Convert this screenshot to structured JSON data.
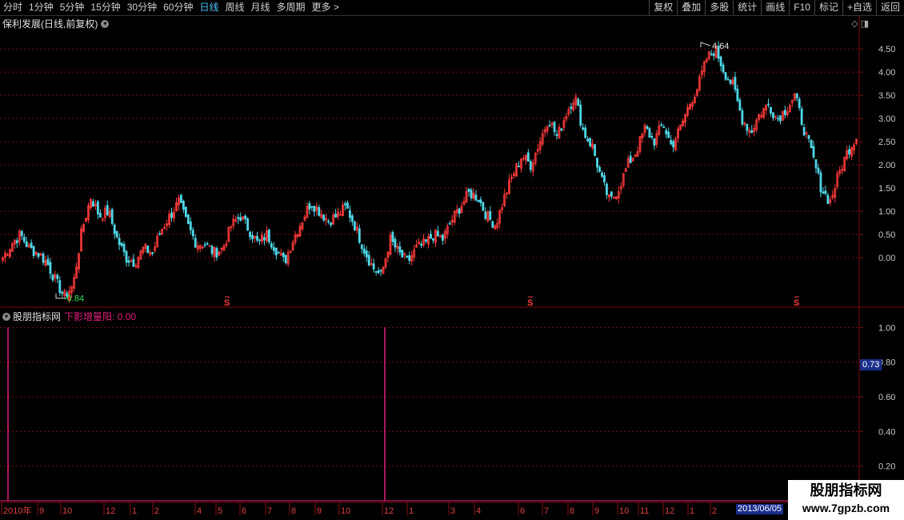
{
  "toolbar": {
    "periods": [
      "分时",
      "1分钟",
      "5分钟",
      "15分钟",
      "30分钟",
      "60分钟",
      "日线",
      "周线",
      "月线",
      "多周期",
      "更多 >"
    ],
    "active_period": "日线",
    "right_buttons": [
      "复权",
      "叠加",
      "多股",
      "统计",
      "画线",
      "F10",
      "标记",
      "+自选",
      "返回"
    ]
  },
  "main_panel": {
    "title": "保利发展(日线,前复权)",
    "icon": "chevron-down-icon",
    "high_label": "4.64",
    "low_label": "-0.84",
    "marker": "S",
    "price_axis": [
      "4.50",
      "4.00",
      "3.50",
      "3.00",
      "2.50",
      "2.00",
      "1.50",
      "1.00",
      "0.50",
      "0.00"
    ]
  },
  "indicator_panel": {
    "title": "股朋指标网",
    "label": "下影增量阳: 0.00",
    "axis": [
      "1.00",
      "0.80",
      "0.60",
      "0.40",
      "0.20"
    ],
    "current_value": "0.73"
  },
  "time_axis": {
    "labels": [
      "2010年",
      "9",
      "10",
      "12",
      "1",
      "2",
      "4",
      "5",
      "6",
      "7",
      "8",
      "9",
      "10",
      "12",
      "1",
      "3",
      "4",
      "6",
      "7",
      "8",
      "9",
      "10",
      "11",
      "12",
      "1",
      "2"
    ],
    "cursor_date": "2013/06/05"
  },
  "watermark": {
    "line1": "股朋指标网",
    "line2": "www.7gpzb.com"
  },
  "colors": {
    "up": "#ff3b3b",
    "down": "#4fd8e8",
    "grid": "#7a0c0c",
    "indicator": "#e0207a",
    "highlight": "#1a2e8c"
  },
  "chart_data": {
    "type": "candlestick",
    "ylim": [
      -1.0,
      4.9
    ],
    "high": 4.64,
    "low": -0.84,
    "close_path": [
      0.0,
      0.3,
      0.5,
      0.2,
      0.1,
      -0.1,
      -0.5,
      -0.84,
      -0.6,
      0.6,
      1.3,
      0.9,
      1.0,
      0.4,
      0.0,
      -0.1,
      0.2,
      0.1,
      0.6,
      0.9,
      1.2,
      0.7,
      0.3,
      0.3,
      0.1,
      0.2,
      0.7,
      0.9,
      0.6,
      0.3,
      0.5,
      0.2,
      -0.1,
      0.4,
      0.8,
      1.2,
      1.0,
      0.8,
      0.9,
      1.1,
      0.7,
      0.2,
      -0.2,
      -0.4,
      0.4,
      0.1,
      -0.1,
      0.2,
      0.3,
      0.5,
      0.4,
      0.8,
      1.1,
      1.4,
      1.3,
      0.9,
      0.7,
      1.3,
      1.8,
      2.2,
      2.0,
      2.5,
      3.0,
      2.6,
      3.1,
      3.5,
      2.7,
      2.4,
      1.7,
      1.2,
      1.5,
      2.0,
      2.3,
      2.8,
      2.5,
      2.9,
      2.4,
      2.8,
      3.3,
      3.7,
      4.3,
      4.5,
      4.0,
      3.7,
      3.0,
      2.7,
      3.1,
      3.3,
      3.0,
      3.2,
      3.5,
      2.8,
      2.2,
      1.5,
      1.2,
      1.8,
      2.3,
      2.6
    ]
  }
}
